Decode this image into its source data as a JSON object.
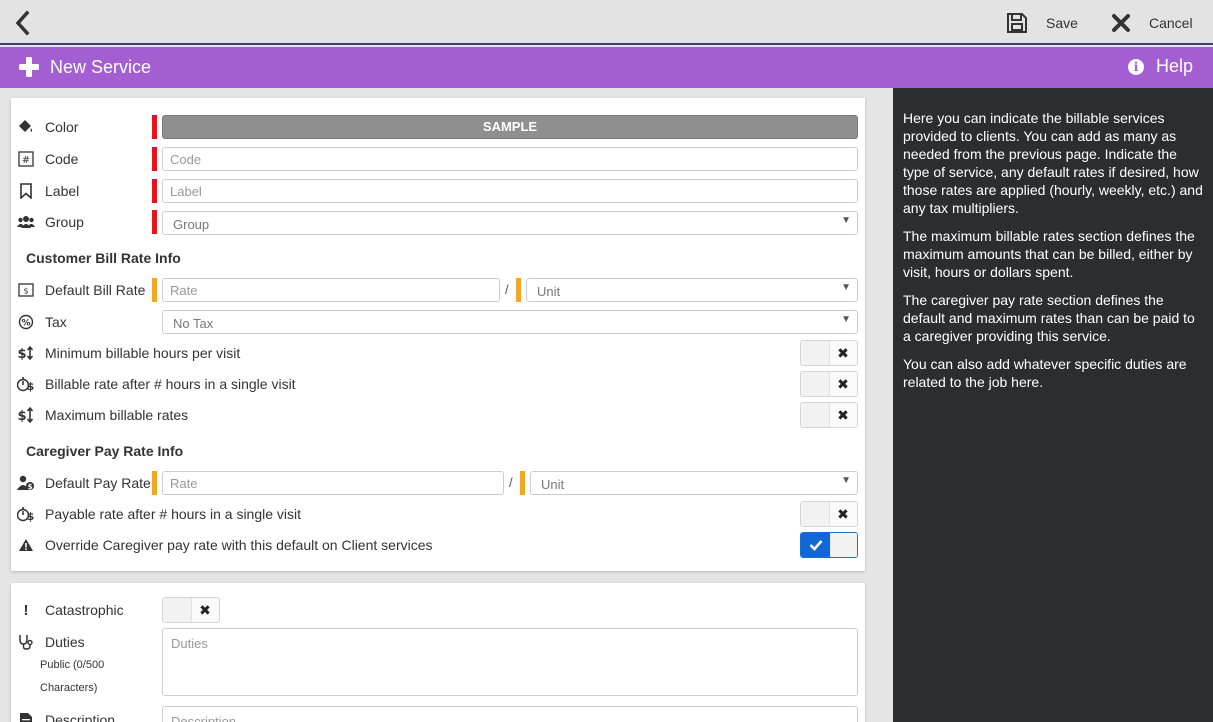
{
  "topbar": {
    "back_icon": "chevron-left-icon",
    "save_label": "Save",
    "cancel_label": "Cancel"
  },
  "titlebar": {
    "title": "New Service",
    "help_label": "Help",
    "accent_color": "#a35fd1"
  },
  "help_text": [
    "Here you can indicate the billable services provided to clients. You can add as many as needed from the previous page. Indicate the type of service, any default rates if desired, how those rates are applied (hourly, weekly, etc.) and any tax multipliers.",
    "The maximum billable rates section defines the maximum amounts that can be billed, either by visit, hours or dollars spent.",
    "The caregiver pay rate section defines the default and maximum rates than can be paid to a caregiver providing this service.",
    "You can also add whatever specific duties are related to the job here."
  ],
  "form": {
    "color": {
      "label": "Color",
      "value": "SAMPLE"
    },
    "code": {
      "label": "Code",
      "placeholder": "Code"
    },
    "label": {
      "label": "Label",
      "placeholder": "Label"
    },
    "group": {
      "label": "Group",
      "value": "Group"
    },
    "customer_section": "Customer Bill Rate Info",
    "default_bill_rate": {
      "label": "Default Bill Rate",
      "placeholder": "Rate",
      "unit": "Unit"
    },
    "tax": {
      "label": "Tax",
      "value": "No Tax"
    },
    "min_billable_hours": {
      "label": "Minimum billable hours per visit",
      "enabled": false
    },
    "billable_rate_after": {
      "label": "Billable rate after # hours in a single visit",
      "enabled": false
    },
    "max_billable_rates": {
      "label": "Maximum billable rates",
      "enabled": false
    },
    "caregiver_section": "Caregiver Pay Rate Info",
    "default_pay_rate": {
      "label": "Default Pay Rate",
      "placeholder": "Rate",
      "unit": "Unit"
    },
    "payable_rate_after": {
      "label": "Payable rate after # hours in a single visit",
      "enabled": false
    },
    "override_pay_rate": {
      "label": "Override Caregiver pay rate with this default on Client services",
      "enabled": true
    }
  },
  "form2": {
    "catastrophic": {
      "label": "Catastrophic",
      "enabled": false
    },
    "duties": {
      "label": "Duties",
      "placeholder": "Duties",
      "counter_line1": "Public (0/500",
      "counter_line2": "Characters)"
    },
    "description": {
      "label": "Description",
      "placeholder": "Description"
    }
  },
  "colors": {
    "required": "#e8141c",
    "recommended": "#f5a623",
    "toggle_on": "#1068d5",
    "help_bg": "#2b2e31"
  }
}
